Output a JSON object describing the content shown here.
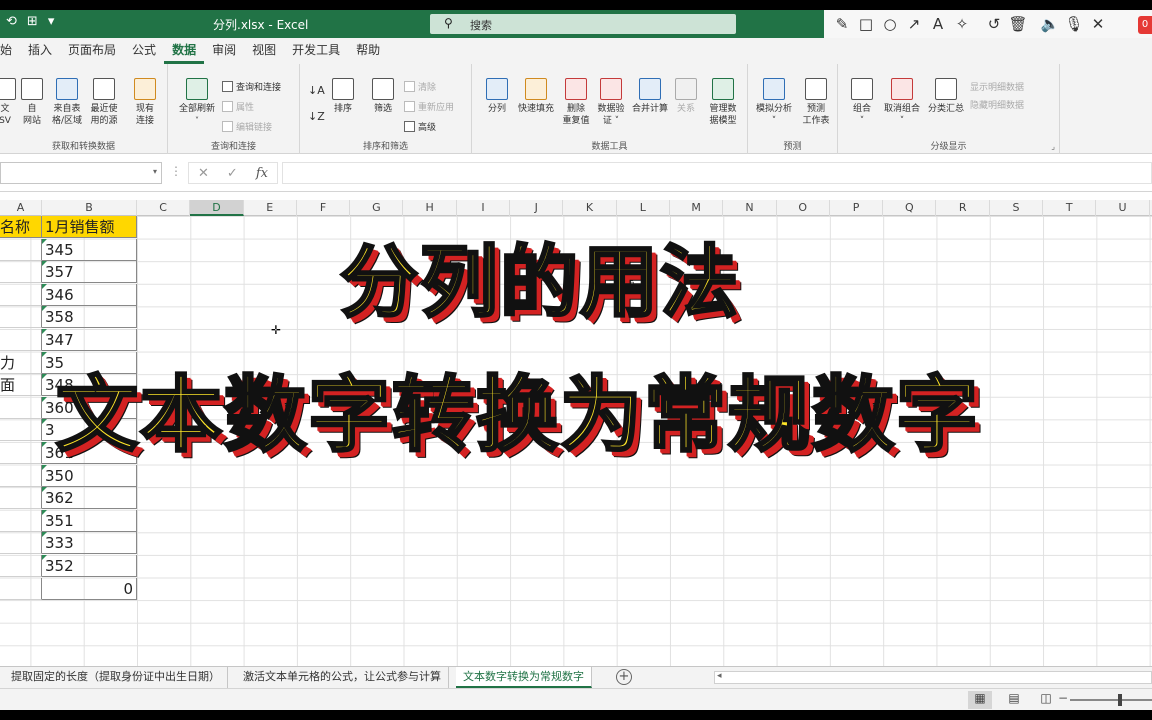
{
  "window": {
    "title": "分列.xlsx - Excel",
    "search_placeholder": "搜索"
  },
  "qat": {
    "autosave": "⟲",
    "redo": "↷",
    "menu": "▾"
  },
  "annotation_toolbar": {
    "badge": "0"
  },
  "ribbon_tabs": [
    "始",
    "插入",
    "页面布局",
    "公式",
    "数据",
    "审阅",
    "视图",
    "开发工具",
    "帮助"
  ],
  "active_tab": "数据",
  "ribbon": {
    "get_data": {
      "label": "获取和转换数据",
      "buttons": [
        "文\nSV",
        "自\n网站",
        "来自表\n格/区域",
        "最近使\n用的源",
        "现有\n连接"
      ]
    },
    "queries": {
      "label": "查询和连接",
      "refresh_all": "全部刷新",
      "queries_connections": "查询和连接",
      "properties": "属性",
      "edit_links": "编辑链接"
    },
    "sort_filter": {
      "label": "排序和筛选",
      "sort": "排序",
      "filter": "筛选",
      "clear": "清除",
      "reapply": "重新应用",
      "advanced": "高级"
    },
    "data_tools": {
      "label": "数据工具",
      "text_to_columns": "分列",
      "flash_fill": "快速填充",
      "remove_duplicates": "删除\n重复值",
      "data_validation": "数据验\n证 ˅",
      "consolidate": "合并计算",
      "relationships": "关系",
      "data_model": "管理数\n据模型"
    },
    "forecast": {
      "label": "预测",
      "what_if": "模拟分析\n˅",
      "forecast_sheet": "预测\n工作表"
    },
    "outline": {
      "label": "分级显示",
      "group": "组合\n˅",
      "ungroup": "取消组合\n˅",
      "subtotal": "分类汇总",
      "show_detail": "显示明细数据",
      "hide_detail": "隐藏明细数据"
    }
  },
  "formula_bar": {
    "name_box": "",
    "fx": "fx",
    "content": ""
  },
  "columns": [
    "A",
    "B",
    "C",
    "D",
    "E",
    "F",
    "G",
    "H",
    "I",
    "J",
    "K",
    "L",
    "M",
    "N",
    "O",
    "P",
    "Q",
    "R",
    "S",
    "T",
    "U"
  ],
  "selected_column": "D",
  "sheet": {
    "header_a": "名称",
    "header_b": "1月销售额",
    "col_a_fragments": {
      "row6": "力",
      "row7": "面"
    },
    "values": [
      "345",
      "357",
      "346",
      "358",
      "347",
      "35",
      "348",
      "360",
      "3",
      "361",
      "350",
      "362",
      "351",
      "333",
      "352"
    ],
    "total": "0",
    "ghost_text_left": "常",
    "ghost_text_right": "规"
  },
  "overlay": {
    "line1": "分列的用法",
    "line2": "文本数字转换为常规数字"
  },
  "sheet_tabs": [
    "提取固定的长度（提取身份证中出生日期）",
    "激活文本单元格的公式，让公式参与计算",
    "文本数字转换为常规数字"
  ],
  "active_sheet": "文本数字转换为常规数字",
  "colors": {
    "excel_green": "#217346",
    "header_fill": "#ffd700",
    "overlay_text": "#ffe629",
    "overlay_shadow": "#d32222"
  }
}
